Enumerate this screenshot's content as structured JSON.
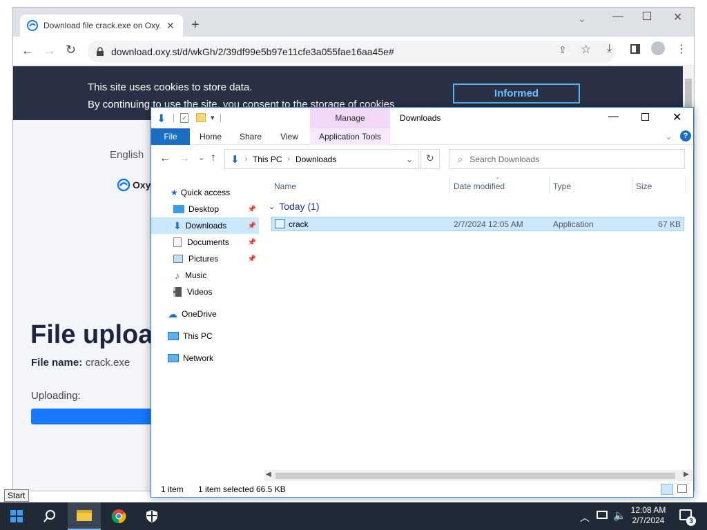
{
  "desktop": {
    "start_tooltip": "Start"
  },
  "taskbar": {
    "clock_time": "12:08 AM",
    "clock_date": "2/7/2024",
    "notification_count": "3"
  },
  "browser": {
    "tab_title": "Download file crack.exe on Oxy.Cloud",
    "url": "download.oxy.st/d/wkGh/2/39df99e5b97e11cfe3a055fae16aa45e#",
    "cookie_line1": "This site uses cookies to store data.",
    "cookie_line2": "By continuing to use the site, you consent to the storage of cookies",
    "informed_label": "Informed",
    "language": "English",
    "logo_text": "Oxy.C",
    "upload_heading": "File uploa",
    "file_name_label": "File name:",
    "file_name_value": "crack.exe",
    "uploading_label": "Uploading:",
    "accent_color": "#1677ff"
  },
  "explorer": {
    "title": "Downloads",
    "manage_label": "Manage",
    "ribbon": {
      "file": "File",
      "home": "Home",
      "share": "Share",
      "view": "View",
      "app_tools": "Application Tools"
    },
    "breadcrumb": [
      "This PC",
      "Downloads"
    ],
    "search_placeholder": "Search Downloads",
    "nav": {
      "quick_access": "Quick access",
      "desktop": "Desktop",
      "downloads": "Downloads",
      "documents": "Documents",
      "pictures": "Pictures",
      "music": "Music",
      "videos": "Videos",
      "onedrive": "OneDrive",
      "this_pc": "This PC",
      "network": "Network"
    },
    "columns": {
      "name": "Name",
      "date": "Date modified",
      "type": "Type",
      "size": "Size"
    },
    "group_label": "Today (1)",
    "files": [
      {
        "name": "crack",
        "date": "2/7/2024 12:05 AM",
        "type": "Application",
        "size": "67 KB"
      }
    ],
    "status": {
      "count": "1 item",
      "selected": "1 item selected",
      "selected_size": "66.5 KB"
    }
  }
}
